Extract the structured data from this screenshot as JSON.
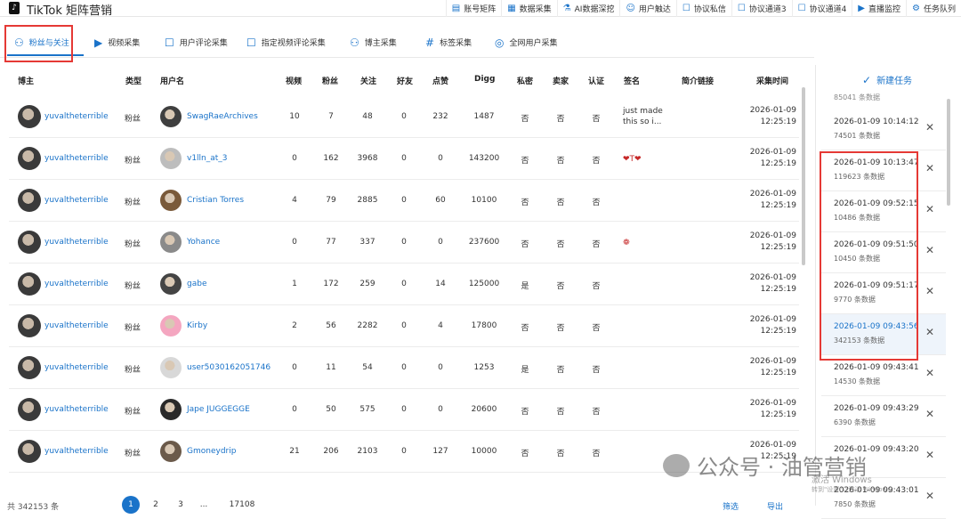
{
  "app": {
    "title": "TikTok 矩阵营销",
    "logo": "♪"
  },
  "topnav": [
    {
      "label": "账号矩阵",
      "icon": "document-icon"
    },
    {
      "label": "数据采集",
      "icon": "grid-icon"
    },
    {
      "label": "AI数据深挖",
      "icon": "flask-icon"
    },
    {
      "label": "用户触达",
      "icon": "user-icon"
    },
    {
      "label": "协议私信",
      "icon": "chat-icon"
    },
    {
      "label": "协议通道3",
      "icon": "chat-icon"
    },
    {
      "label": "协议通道4",
      "icon": "chat-icon"
    },
    {
      "label": "直播监控",
      "icon": "video-icon"
    },
    {
      "label": "任务队列",
      "icon": "queue-icon"
    }
  ],
  "tabs": [
    {
      "label": "粉丝与关注",
      "icon": "users-icon",
      "active": true
    },
    {
      "label": "视频采集",
      "icon": "video-icon"
    },
    {
      "label": "用户评论采集",
      "icon": "comment-icon"
    },
    {
      "label": "指定视频评论采集",
      "icon": "comment-icon"
    },
    {
      "label": "博主采集",
      "icon": "users-icon"
    },
    {
      "label": "标签采集",
      "icon": "hash-icon"
    },
    {
      "label": "全网用户采集",
      "icon": "globe-icon"
    }
  ],
  "table": {
    "headers": [
      "博主",
      "类型",
      "用户名",
      "视频",
      "粉丝",
      "关注",
      "好友",
      "点赞",
      "Digg",
      "私密",
      "卖家",
      "认证",
      "签名",
      "简介链接",
      "采集时间"
    ],
    "rows": [
      {
        "blogger": "yuvaltheterrible",
        "type": "粉丝",
        "user": "SwagRaeArchives",
        "video": "10",
        "fans": "7",
        "follow": "48",
        "friend": "0",
        "likes": "232",
        "digg": "1487",
        "private": "否",
        "seller": "否",
        "verified": "否",
        "sign": "just made this so i...",
        "date": "2026-01-09",
        "time": "12:25:19"
      },
      {
        "blogger": "yuvaltheterrible",
        "type": "粉丝",
        "user": "v1lln_at_3",
        "video": "0",
        "fans": "162",
        "follow": "3968",
        "friend": "0",
        "likes": "0",
        "digg": "143200",
        "private": "否",
        "seller": "否",
        "verified": "否",
        "sign": "❤T❤",
        "date": "2026-01-09",
        "time": "12:25:19"
      },
      {
        "blogger": "yuvaltheterrible",
        "type": "粉丝",
        "user": "Cristian Torres",
        "video": "4",
        "fans": "79",
        "follow": "2885",
        "friend": "0",
        "likes": "60",
        "digg": "10100",
        "private": "否",
        "seller": "否",
        "verified": "否",
        "sign": "",
        "date": "2026-01-09",
        "time": "12:25:19"
      },
      {
        "blogger": "yuvaltheterrible",
        "type": "粉丝",
        "user": "Yohance",
        "video": "0",
        "fans": "77",
        "follow": "337",
        "friend": "0",
        "likes": "0",
        "digg": "237600",
        "private": "否",
        "seller": "否",
        "verified": "否",
        "sign": "❁",
        "date": "2026-01-09",
        "time": "12:25:19"
      },
      {
        "blogger": "yuvaltheterrible",
        "type": "粉丝",
        "user": "gabe",
        "video": "1",
        "fans": "172",
        "follow": "259",
        "friend": "0",
        "likes": "14",
        "digg": "125000",
        "private": "是",
        "seller": "否",
        "verified": "否",
        "sign": "",
        "date": "2026-01-09",
        "time": "12:25:19"
      },
      {
        "blogger": "yuvaltheterrible",
        "type": "粉丝",
        "user": "Kirby",
        "video": "2",
        "fans": "56",
        "follow": "2282",
        "friend": "0",
        "likes": "4",
        "digg": "17800",
        "private": "否",
        "seller": "否",
        "verified": "否",
        "sign": "",
        "date": "2026-01-09",
        "time": "12:25:19"
      },
      {
        "blogger": "yuvaltheterrible",
        "type": "粉丝",
        "user": "user5030162051746",
        "video": "0",
        "fans": "11",
        "follow": "54",
        "friend": "0",
        "likes": "0",
        "digg": "1253",
        "private": "是",
        "seller": "否",
        "verified": "否",
        "sign": "",
        "date": "2026-01-09",
        "time": "12:25:19"
      },
      {
        "blogger": "yuvaltheterrible",
        "type": "粉丝",
        "user": "Jape JUGGEGGE",
        "video": "0",
        "fans": "50",
        "follow": "575",
        "friend": "0",
        "likes": "0",
        "digg": "20600",
        "private": "否",
        "seller": "否",
        "verified": "否",
        "sign": "",
        "date": "2026-01-09",
        "time": "12:25:19"
      },
      {
        "blogger": "yuvaltheterrible",
        "type": "粉丝",
        "user": "Gmoneydrip",
        "video": "21",
        "fans": "206",
        "follow": "2103",
        "friend": "0",
        "likes": "127",
        "digg": "10000",
        "private": "否",
        "seller": "否",
        "verified": "否",
        "sign": "",
        "date": "2026-01-09",
        "time": "12:25:19"
      }
    ]
  },
  "side": {
    "new_task_label": "新建任务",
    "top_partial": "85041 条数据",
    "tasks": [
      {
        "time": "2026-01-09 10:14:12",
        "count": "74501 条数据"
      },
      {
        "time": "2026-01-09 10:13:47",
        "count": "119623 条数据"
      },
      {
        "time": "2026-01-09 09:52:15",
        "count": "10486 条数据"
      },
      {
        "time": "2026-01-09 09:51:50",
        "count": "10450 条数据"
      },
      {
        "time": "2026-01-09 09:51:17",
        "count": "9770 条数据"
      },
      {
        "time": "2026-01-09 09:43:56",
        "count": "342153 条数据",
        "selected": true
      },
      {
        "time": "2026-01-09 09:43:41",
        "count": "14530 条数据"
      },
      {
        "time": "2026-01-09 09:43:29",
        "count": "6390 条数据"
      },
      {
        "time": "2026-01-09 09:43:20",
        "count": ""
      },
      {
        "time": "2026-01-09 09:43:01",
        "count": "7850 条数据"
      }
    ]
  },
  "footer": {
    "total": "共 342153 条",
    "pages": [
      "1",
      "2",
      "3",
      "...",
      "17108"
    ],
    "filter": "筛选",
    "export": "导出"
  },
  "watermark": {
    "text": "公众号 · 油管营销",
    "windows_line1": "激活 Windows",
    "windows_line2": "转到\"设置\"以激活 Windows。"
  },
  "colors": {
    "accent": "#1a73c9",
    "highlight": "#e53935"
  }
}
